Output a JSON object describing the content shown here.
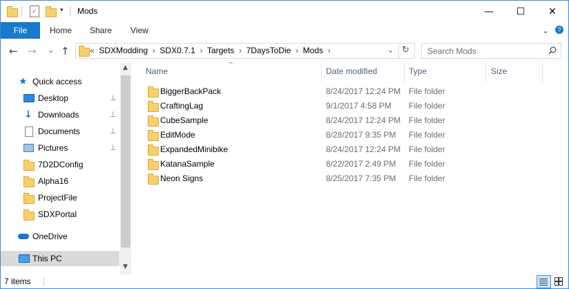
{
  "window": {
    "title": "Mods",
    "minimize_glyph": "—",
    "maximize_glyph": "☐",
    "close_glyph": "✕",
    "help_glyph": "?",
    "expand_ribbon_glyph": "⌄"
  },
  "ribbon": {
    "tabs": [
      "File",
      "Home",
      "Share",
      "View"
    ]
  },
  "nav": {
    "back_glyph": "←",
    "forward_glyph": "→",
    "recent_glyph": "⌄",
    "up_glyph": "↑"
  },
  "address": {
    "overflow": "«",
    "crumbs": [
      "SDXModding",
      "SDX0.7.1",
      "Targets",
      "7DaysToDie",
      "Mods"
    ],
    "separator": "›",
    "refresh_glyph": "↻",
    "dropdown_glyph": "⌄"
  },
  "search": {
    "placeholder": "Search Mods"
  },
  "sidebar": {
    "quick_access": "Quick access",
    "items": [
      {
        "label": "Desktop",
        "icon": "desktop-icon",
        "pinned": true
      },
      {
        "label": "Downloads",
        "icon": "downloads-icon",
        "pinned": true
      },
      {
        "label": "Documents",
        "icon": "documents-icon",
        "pinned": true
      },
      {
        "label": "Pictures",
        "icon": "pictures-icon",
        "pinned": true
      },
      {
        "label": "7D2DConfig",
        "icon": "folder-icon",
        "pinned": false
      },
      {
        "label": "Alpha16",
        "icon": "folder-icon",
        "pinned": false
      },
      {
        "label": "ProjectFile",
        "icon": "folder-icon",
        "pinned": false
      },
      {
        "label": "SDXPortal",
        "icon": "folder-icon",
        "pinned": false
      }
    ],
    "onedrive": "OneDrive",
    "this_pc": "This PC",
    "pin_glyph": "📌"
  },
  "list": {
    "columns": [
      "Name",
      "Date modified",
      "Type",
      "Size"
    ],
    "sort_indicator": "^",
    "rows": [
      {
        "name": "BiggerBackPack",
        "date": "8/24/2017 12:24 PM",
        "type": "File folder"
      },
      {
        "name": "CraftingLag",
        "date": "9/1/2017 4:58 PM",
        "type": "File folder"
      },
      {
        "name": "CubeSample",
        "date": "8/24/2017 12:24 PM",
        "type": "File folder"
      },
      {
        "name": "EditMode",
        "date": "8/28/2017 9:35 PM",
        "type": "File folder"
      },
      {
        "name": "ExpandedMinibike",
        "date": "8/24/2017 12:24 PM",
        "type": "File folder"
      },
      {
        "name": "KatanaSample",
        "date": "8/22/2017 2:49 PM",
        "type": "File folder"
      },
      {
        "name": "Neon Signs",
        "date": "8/25/2017 7:35 PM",
        "type": "File folder"
      }
    ]
  },
  "status": {
    "count": "7 items"
  },
  "colors": {
    "accent": "#1979ca",
    "folder": "#f7d06a",
    "selected": "#cce8ff"
  }
}
